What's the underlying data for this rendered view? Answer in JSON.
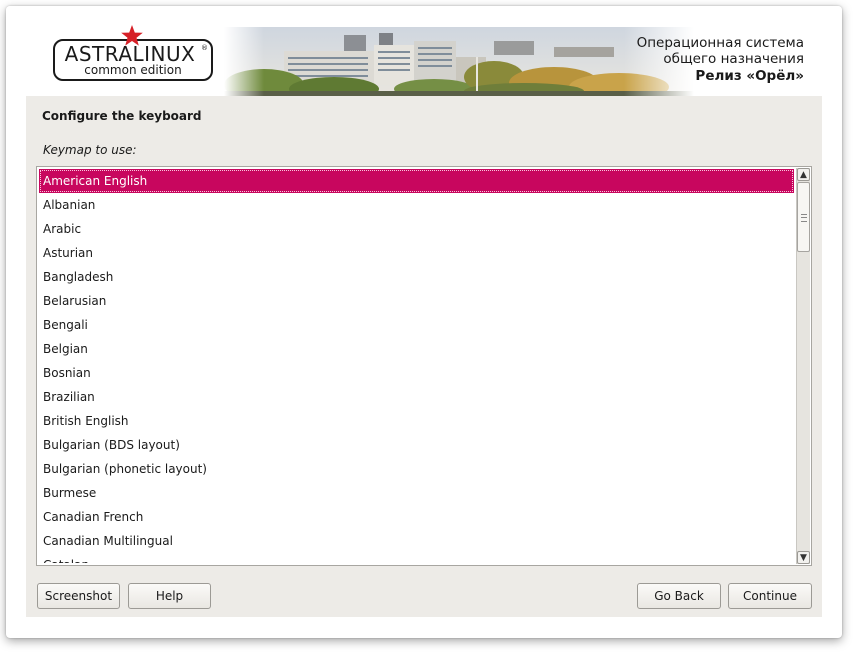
{
  "header": {
    "logo_name": "ASTRALINUX",
    "logo_reg": "®",
    "logo_edition": "common edition",
    "os_line1": "Операционная система",
    "os_line2": "общего назначения",
    "release": "Релиз «Орёл»",
    "logo_star_color": "#d62027"
  },
  "panel": {
    "title": "Configure the keyboard",
    "keymap_label": "Keymap to use:"
  },
  "keymap_list": {
    "selected_color": "#c8065e",
    "items": [
      {
        "label": "American English",
        "selected": true
      },
      {
        "label": "Albanian",
        "selected": false
      },
      {
        "label": "Arabic",
        "selected": false
      },
      {
        "label": "Asturian",
        "selected": false
      },
      {
        "label": "Bangladesh",
        "selected": false
      },
      {
        "label": "Belarusian",
        "selected": false
      },
      {
        "label": "Bengali",
        "selected": false
      },
      {
        "label": "Belgian",
        "selected": false
      },
      {
        "label": "Bosnian",
        "selected": false
      },
      {
        "label": "Brazilian",
        "selected": false
      },
      {
        "label": "British English",
        "selected": false
      },
      {
        "label": "Bulgarian (BDS layout)",
        "selected": false
      },
      {
        "label": "Bulgarian (phonetic layout)",
        "selected": false
      },
      {
        "label": "Burmese",
        "selected": false
      },
      {
        "label": "Canadian French",
        "selected": false
      },
      {
        "label": "Canadian Multilingual",
        "selected": false
      },
      {
        "label": "Catalan",
        "selected": false
      }
    ]
  },
  "buttons": {
    "screenshot": "Screenshot",
    "help": "Help",
    "go_back": "Go Back",
    "continue": "Continue"
  }
}
